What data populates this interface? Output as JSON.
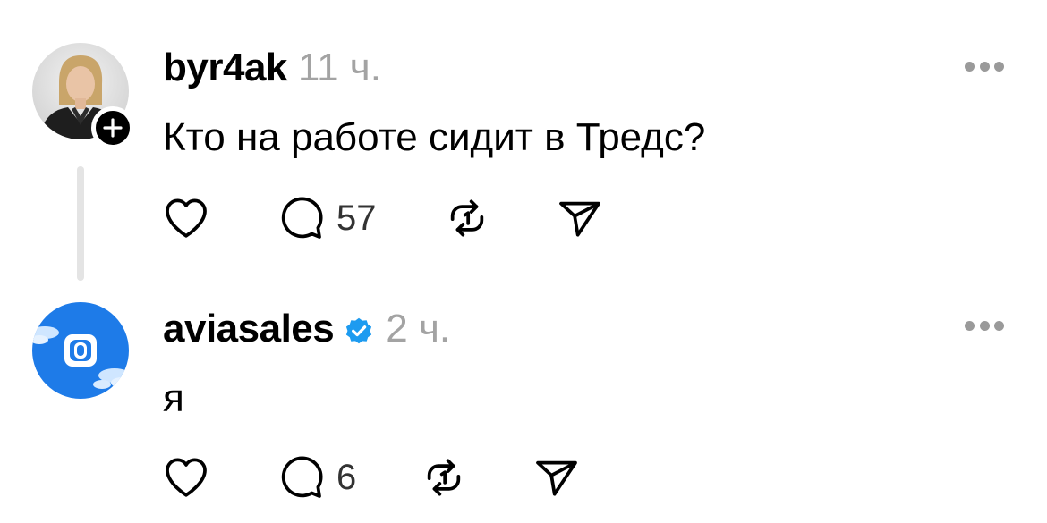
{
  "posts": [
    {
      "username": "byr4ak",
      "time": "11 ч.",
      "text": "Кто на работе сидит в Тредс?",
      "replies_count": "57",
      "verified": false,
      "avatar_icon": "person-photo-avatar"
    },
    {
      "username": "aviasales",
      "time": "2 ч.",
      "text": "я",
      "replies_count": "6",
      "verified": true,
      "avatar_icon": "aviasales-logo-avatar"
    }
  ],
  "icons": {
    "like": "heart-icon",
    "reply": "speech-bubble-icon",
    "repost": "repost-icon",
    "share": "send-icon",
    "more": "more-dots-icon",
    "follow": "plus-icon",
    "verified": "verified-badge-icon"
  },
  "colors": {
    "verified": "#1d9bf0",
    "muted": "#a3a3a3",
    "avatar_blue": "#1e7be8"
  }
}
